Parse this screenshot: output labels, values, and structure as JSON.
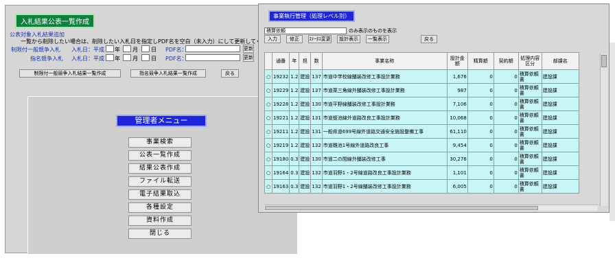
{
  "bid_window": {
    "title": "入札結果公表一覧作成",
    "section_link": "公表対象入札結果追加",
    "instruction": "一覧から削除したい場合は、削除したい入札日を指定しPDF名を空白（未入力）にして更新してください。",
    "rows": [
      {
        "label": "制限付一般競争入札",
        "date_label": "入札日：平成",
        "year": "年",
        "month": "月",
        "day": "日",
        "pdf_label": "PDF名：",
        "button": "更新"
      },
      {
        "label": "指名競争入札",
        "date_label": "入札日：平成",
        "year": "年",
        "month": "月",
        "day": "日",
        "pdf_label": "PDF名：",
        "button": "更新"
      }
    ],
    "bottom_buttons": [
      "制限付一般競争入札結果一覧作成",
      "指名競争入札結果一覧作成",
      "戻る"
    ]
  },
  "admin_menu": {
    "title": "管理者メニュー",
    "items": [
      "事業検索",
      "公表一覧作成",
      "結果公表作成",
      "ファイル転送",
      "電子結果取込",
      "各種設定",
      "資料作成",
      "閉じる"
    ]
  },
  "project_window": {
    "title": "事業執行管理（処理レベル別）",
    "filter_value": "積算依頼",
    "filter_suffix": "のみ表示のものを表示",
    "buttons": [
      "入力",
      "修正",
      "ｽﾃｰﾀｽ変更",
      "設計表示",
      "一覧表示",
      "戻る"
    ],
    "columns": [
      "",
      "通番",
      "年",
      "担",
      "数",
      "事業名称",
      "設計金額",
      "精算額",
      "契約額",
      "処理内容区分",
      "部課名"
    ],
    "rows": [
      {
        "no": "19232",
        "year": "1.2",
        "tan": "建設",
        "cnt": "137",
        "name": "市道中学校線舗装改修工事設計業務",
        "amount": "1,676",
        "settle": "0",
        "contract": "0",
        "status": "積算依頼書",
        "dept": "建設課"
      },
      {
        "no": "19229",
        "year": "1.2",
        "tan": "建設",
        "cnt": "137",
        "name": "市道栗三角線外舗装改修工事設計業務",
        "amount": "987",
        "settle": "0",
        "contract": "0",
        "status": "積算依頼書",
        "dept": "建設課"
      },
      {
        "no": "19228",
        "year": "1.2",
        "tan": "建設",
        "cnt": "130",
        "name": "市道平野線舗装改修工事設計業務",
        "amount": "7,106",
        "settle": "0",
        "contract": "0",
        "status": "積算依頼書",
        "dept": "建設課"
      },
      {
        "no": "19221",
        "year": "1.2",
        "tan": "建設",
        "cnt": "131",
        "name": "市道蛭池線外道路改良工事設計業務",
        "amount": "10,068",
        "settle": "0",
        "contract": "0",
        "status": "積算依頼書",
        "dept": "建設課"
      },
      {
        "no": "19211",
        "year": "1.2",
        "tan": "建設",
        "cnt": "131",
        "name": "一般県道699号線外道路交通安全施設整備工事",
        "amount": "61,110",
        "settle": "0",
        "contract": "0",
        "status": "積算依頼書",
        "dept": "建設課"
      },
      {
        "no": "19219",
        "year": "1.2",
        "tan": "建設",
        "cnt": "132",
        "name": "市道雛池1号線外道路改良工事",
        "amount": "9,454",
        "settle": "0",
        "contract": "0",
        "status": "積算依頼書",
        "dept": "建設課"
      },
      {
        "no": "19180",
        "year": "0.3",
        "tan": "建設",
        "cnt": "130",
        "name": "市道二の間線外舗装改修工事",
        "amount": "30,276",
        "settle": "0",
        "contract": "0",
        "status": "積算依頼書",
        "dept": "建設課"
      },
      {
        "no": "19164",
        "year": "0.3",
        "tan": "建設",
        "cnt": "132",
        "name": "市道羽野1・2号線道路改良工事設計業務",
        "amount": "1,101",
        "settle": "0",
        "contract": "0",
        "status": "積算依頼書",
        "dept": "建設課"
      },
      {
        "no": "19163",
        "year": "0.3",
        "tan": "建設",
        "cnt": "132",
        "name": "市道羽野1・2号線舗装改修工事設計業務",
        "amount": "6,005",
        "settle": "0",
        "contract": "0",
        "status": "積算依頼書",
        "dept": "建設課"
      }
    ]
  }
}
